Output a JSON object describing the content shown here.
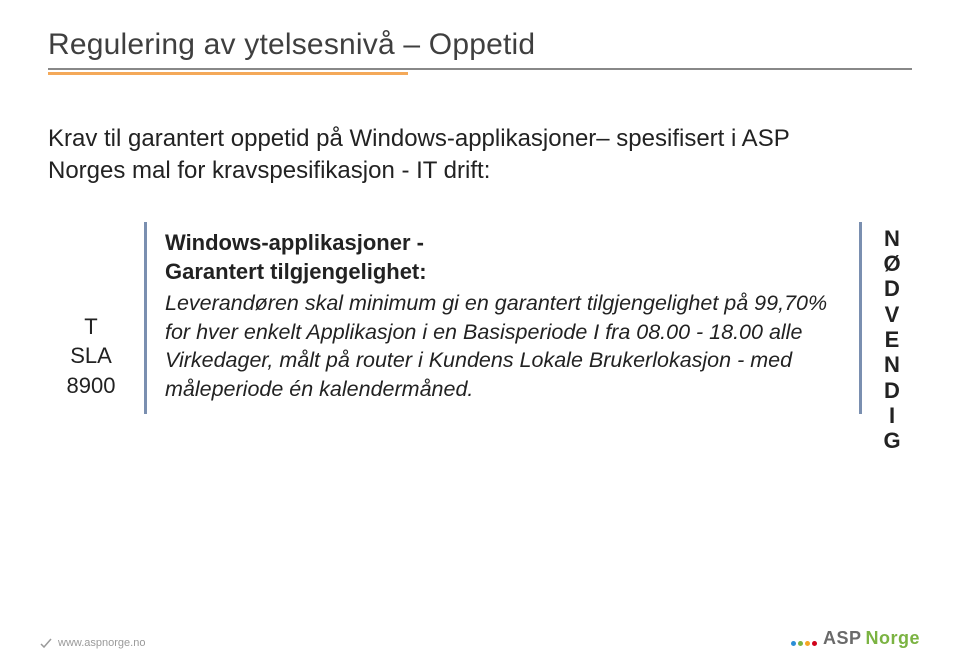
{
  "title": "Regulering av ytelsesnivå – Oppetid",
  "intro": "Krav til garantert oppetid på Windows-applikasjoner– spesifisert i ASP Norges mal for kravspesifikasjon - IT drift:",
  "code": {
    "line1": "T",
    "line2": "SLA",
    "line3": "8900"
  },
  "body": {
    "h2": "Windows-applikasjoner -",
    "h3": "Garantert tilgjengelighet:",
    "p": "Leverandøren skal minimum gi en garantert tilgjengelighet på 99,70% for hver enkelt Applikasjon i en Basisperiode I fra 08.00 - 18.00 alle Virkedager, målt på router i Kundens Lokale Brukerlokasjon - med måleperiode én kalendermåned."
  },
  "priority": "NØDVENDIG",
  "footer": {
    "url": "www.aspnorge.no",
    "brand_asp": "ASP",
    "brand_norge": "Norge"
  }
}
